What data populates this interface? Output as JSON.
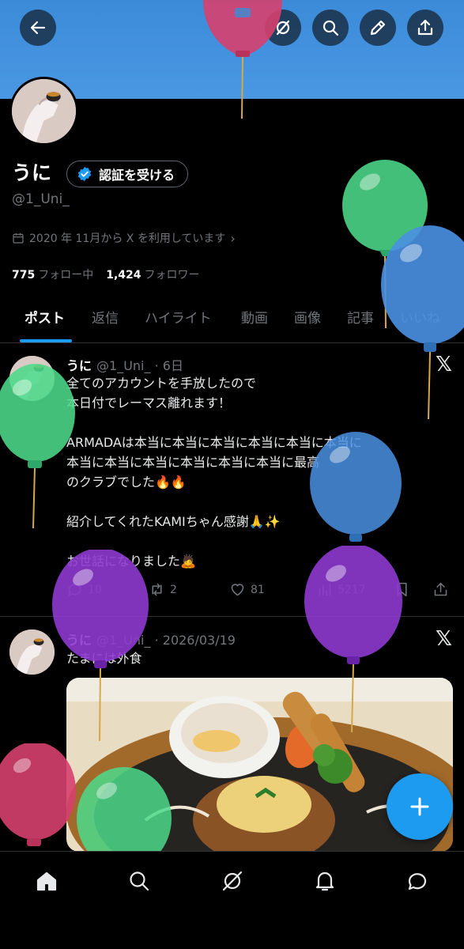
{
  "topbar": {
    "back_icon": "arrow-left-icon",
    "grok_icon": "grok-icon",
    "search_icon": "search-icon",
    "edit_icon": "pencil-icon",
    "share_icon": "share-icon"
  },
  "profile": {
    "name": "うに",
    "verify_label": "認証を受ける",
    "handle": "@1_Uni_",
    "joined": "2020 年 11月から X を利用しています",
    "following_count": "775",
    "following_label": "フォロー中",
    "followers_count": "1,424",
    "followers_label": "フォロワー"
  },
  "tabs": [
    "ポスト",
    "返信",
    "ハイライト",
    "動画",
    "画像",
    "記事",
    "いいね"
  ],
  "posts": [
    {
      "name": "うに",
      "handle": "@1_Uni_",
      "time": "· 6日",
      "body": "全てのアカウントを手放したので\n本日付でレーマス離れます！\n\nARMADAは本当に本当に本当に本当に本当に本当に\n本当に本当に本当に本当に本当に本当に最高\nのクラブでした🔥🔥\n\n紹介してくれたKAMIちゃん感謝🙏✨\n\nお世話になりました🙇",
      "replies": "10",
      "reposts": "2",
      "likes": "81",
      "views": "5217"
    },
    {
      "name": "うに",
      "handle": "@1_Uni_",
      "time": "· 2026/03/19",
      "body": "たまには外食"
    }
  ],
  "colors": {
    "accent": "#1d9bf0",
    "banner": "#4a98e3",
    "background": "#000000"
  }
}
